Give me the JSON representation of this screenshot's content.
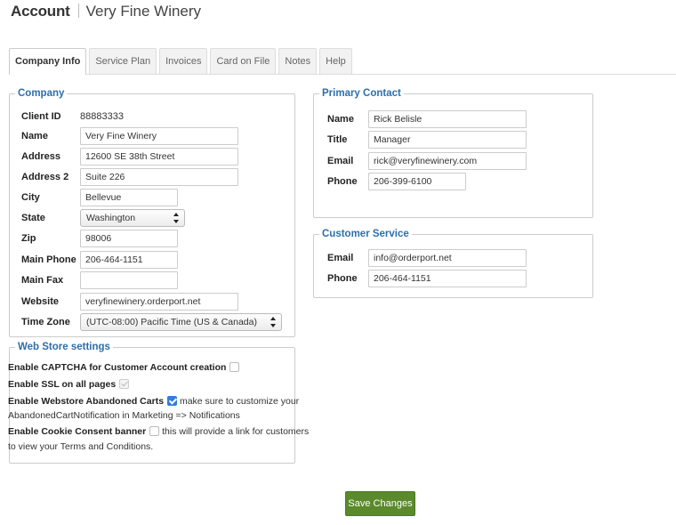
{
  "header": {
    "title": "Account",
    "company": "Very Fine Winery"
  },
  "tabs": [
    {
      "label": "Company Info"
    },
    {
      "label": "Service Plan"
    },
    {
      "label": "Invoices"
    },
    {
      "label": "Card on File"
    },
    {
      "label": "Notes"
    },
    {
      "label": "Help"
    }
  ],
  "company": {
    "legend": "Company",
    "client_id": {
      "label": "Client ID",
      "value": "88883333"
    },
    "name": {
      "label": "Name",
      "value": "Very Fine Winery"
    },
    "address": {
      "label": "Address",
      "value": "12600 SE 38th Street"
    },
    "address2": {
      "label": "Address 2",
      "value": "Suite 226"
    },
    "city": {
      "label": "City",
      "value": "Bellevue"
    },
    "state": {
      "label": "State",
      "value": "Washington"
    },
    "zip": {
      "label": "Zip",
      "value": "98006"
    },
    "main_phone": {
      "label": "Main Phone",
      "value": "206-464-1151"
    },
    "main_fax": {
      "label": "Main Fax",
      "value": ""
    },
    "website": {
      "label": "Website",
      "value": "veryfinewinery.orderport.net"
    },
    "time_zone": {
      "label": "Time Zone",
      "value": "(UTC-08:00) Pacific Time (US & Canada)"
    }
  },
  "webstore": {
    "legend": "Web Store settings",
    "captcha": {
      "label": "Enable CAPTCHA for Customer Account creation",
      "checked": false
    },
    "ssl": {
      "label": "Enable SSL on all pages",
      "checked": true,
      "disabled": true
    },
    "abandoned": {
      "label": "Enable Webstore Abandoned Carts",
      "checked": true,
      "note_line1": "make sure to customize your",
      "note_line2": "AbandonedCartNotification in Marketing => Notifications"
    },
    "cookie": {
      "label": "Enable Cookie Consent banner",
      "checked": false,
      "note_line1": "this will provide a link for customers",
      "note_line2": "to view your Terms and Conditions."
    }
  },
  "primary_contact": {
    "legend": "Primary Contact",
    "name": {
      "label": "Name",
      "value": "Rick Belisle"
    },
    "title": {
      "label": "Title",
      "value": "Manager"
    },
    "email": {
      "label": "Email",
      "value": "rick@veryfinewinery.com"
    },
    "phone": {
      "label": "Phone",
      "value": "206-399-6100"
    }
  },
  "customer_service": {
    "legend": "Customer Service",
    "email": {
      "label": "Email",
      "value": "info@orderport.net"
    },
    "phone": {
      "label": "Phone",
      "value": "206-464-1151"
    }
  },
  "actions": {
    "save_label": "Save Changes",
    "save_color": "#5a8a2b"
  },
  "colors": {
    "legend": "#2d6fab",
    "checkbox_checked": "#2f7fd8"
  }
}
